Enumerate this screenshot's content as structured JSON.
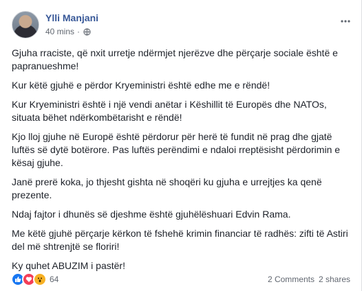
{
  "post": {
    "author": "Ylli Manjani",
    "time": "40 mins",
    "separator": "·",
    "paragraphs": [
      "Gjuha rraciste, që nxit urretje ndërmjet njerëzve dhe përçarje sociale është e papranueshme!",
      "Kur këtë gjuhë e përdor Kryeministri është edhe me e rëndë!",
      "Kur Kryeministri është i një vendi anëtar i Këshillit të Europës dhe NATOs, situata bëhet ndërkombëtarisht e rëndë!",
      "Kjo lloj gjuhe në Europë është përdorur për herë të fundit në prag dhe gjatë luftës së dytë botërore. Pas luftës perëndimi e ndaloi rreptësisht përdorimin e kësaj gjuhe.",
      "Janë prerë koka, jo thjesht gishta në shoqëri ku gjuha e urrejtjes ka qenë prezente.",
      "Ndaj fajtor i dhunës së djeshme është gjuhëlëshuari Edvin Rama.",
      "Me këtë gjuhë përçarje kërkon të fshehë krimin financiar të radhës: zifti të Astiri del më shtrenjtë se floriri!",
      "Ky quhet ABUZIM i pastër!"
    ]
  },
  "footer": {
    "reaction_count": "64",
    "reactions": [
      "like-icon",
      "love-icon",
      "wow-icon"
    ],
    "comments": "2 Comments",
    "shares": "2 shares"
  },
  "colors": {
    "author": "#385898",
    "text": "#1d2129",
    "meta": "#616770",
    "like": "#1877f2",
    "love": "#f33e58",
    "wow": "#f7b125"
  }
}
